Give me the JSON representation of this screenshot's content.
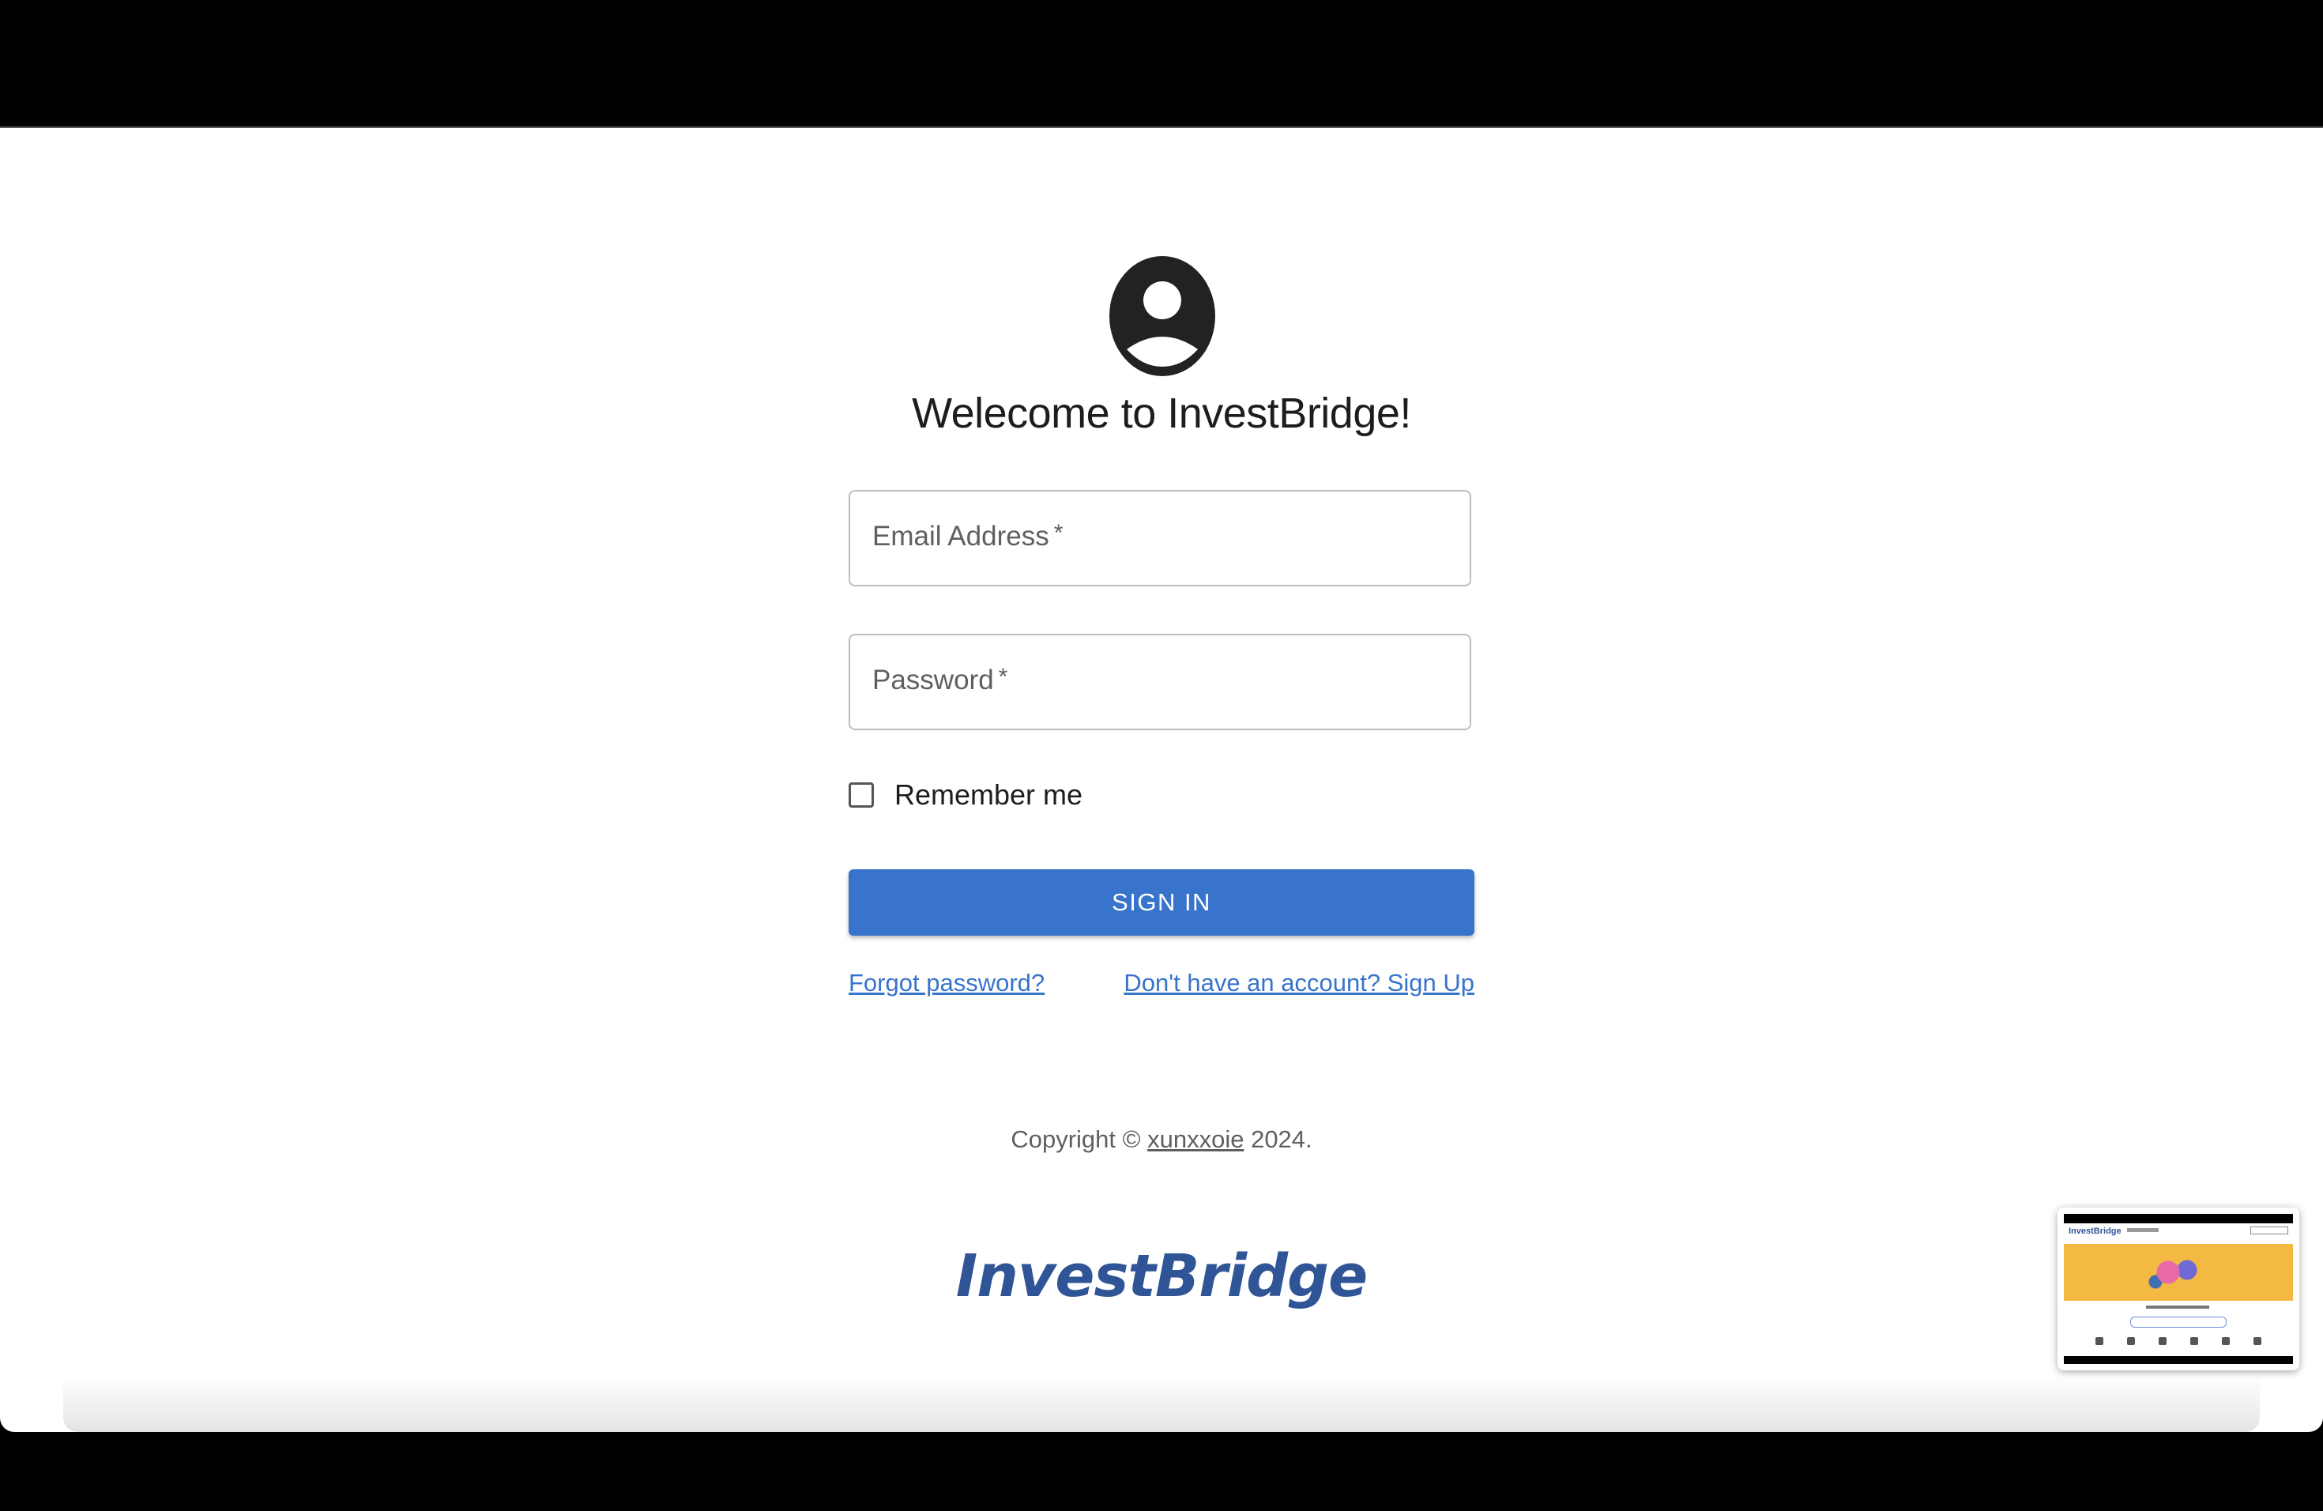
{
  "login": {
    "welcome": "Welecome to InvestBridge!",
    "email_label": "Email Address",
    "password_label": "Password",
    "required_mark": "*",
    "remember_label": "Remember me",
    "signin_label": "SIGN IN",
    "forgot_link": "Forgot password?",
    "signup_link": "Don't have an account? Sign Up"
  },
  "footer": {
    "copyright_prefix": "Copyright ©",
    "copyright_author": "xunxxoie",
    "copyright_suffix": "2024.",
    "brand": "InvestBridge"
  },
  "thumbnail": {
    "logo": "InvestBridge"
  },
  "colors": {
    "primary": "#3874cb",
    "brand": "#2f5597",
    "banner": "#f4b942"
  },
  "icons": {
    "avatar": "account-circle-icon"
  }
}
